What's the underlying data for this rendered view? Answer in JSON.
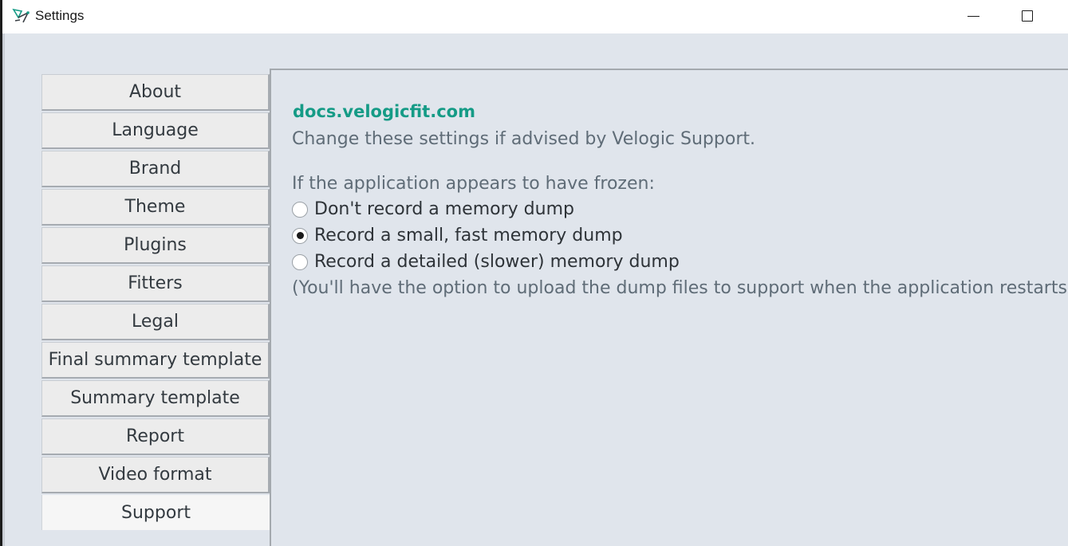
{
  "window": {
    "title": "Settings",
    "minimize_icon": "minimize-icon",
    "maximize_icon": "maximize-icon"
  },
  "nav": {
    "items": [
      {
        "label": "About"
      },
      {
        "label": "Language"
      },
      {
        "label": "Brand"
      },
      {
        "label": "Theme"
      },
      {
        "label": "Plugins"
      },
      {
        "label": "Fitters"
      },
      {
        "label": "Legal"
      },
      {
        "label": "Final summary template"
      },
      {
        "label": "Summary template"
      },
      {
        "label": "Report"
      },
      {
        "label": "Video format"
      },
      {
        "label": "Support",
        "selected": true
      }
    ]
  },
  "support": {
    "docs_link": "docs.velogicfit.com",
    "hint": "Change these settings if advised by Velogic Support.",
    "question": "If the application appears to have frozen:",
    "options": [
      {
        "label": "Don't record a memory dump",
        "checked": false
      },
      {
        "label": "Record a small, fast memory dump",
        "checked": true
      },
      {
        "label": "Record a detailed (slower) memory dump",
        "checked": false
      }
    ],
    "footnote": "(You'll have the option to upload the dump files to support when the application restarts.)"
  },
  "colors": {
    "accent": "#159b86",
    "background": "#e0e5ec"
  }
}
